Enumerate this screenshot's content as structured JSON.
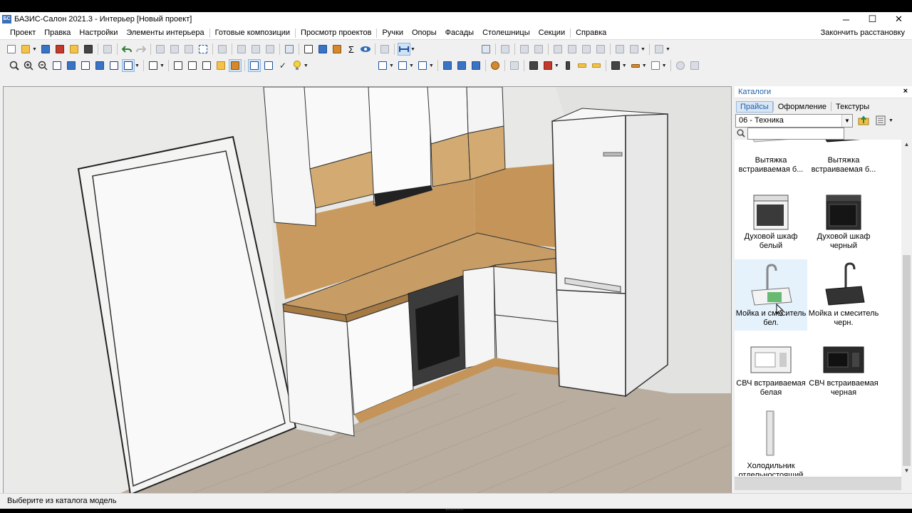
{
  "window": {
    "title": "БАЗИС-Салон 2021.3 - Интерьер [Новый проект]",
    "app_icon_text": "БС",
    "minimize_glyph": "─",
    "maximize_glyph": "☐",
    "close_glyph": "✕"
  },
  "menu": {
    "items": [
      "Проект",
      "Правка",
      "Настройки",
      "Элементы интерьера",
      "Готовые композиции",
      "Просмотр проектов",
      "Ручки",
      "Опоры",
      "Фасады",
      "Столешницы",
      "Секции",
      "Справка"
    ],
    "right_action": "Закончить расстановку"
  },
  "toolbar_icons": {
    "row1": [
      "new-icon",
      "open-icon",
      "save-icon",
      "save-as-icon",
      "export-icon",
      "print-icon",
      "home-icon",
      "undo-icon",
      "redo-icon",
      "cut-icon",
      "copy-icon",
      "paste-icon",
      "select-icon",
      "pick-icon",
      "group-icon",
      "ungroup-icon",
      "edit-icon",
      "layers-icon",
      "specification-icon",
      "3d-view-icon",
      "material-icon",
      "sum-icon",
      "eye-icon",
      "properties-icon",
      "measure-icon"
    ],
    "row2": [
      "zoom-all-icon",
      "zoom-in-icon",
      "zoom-out-icon",
      "view-front-icon",
      "view-left-icon",
      "view-top-icon",
      "view-right-icon",
      "view-iso-icon",
      "wireframe-icon",
      "camera-icon",
      "box-icon",
      "solid-icon",
      "texture-icon",
      "cube-icon",
      "frame-icon",
      "dimension-icon",
      "light-icon"
    ]
  },
  "catalog": {
    "panel_title": "Каталоги",
    "close_glyph": "×",
    "tabs": [
      "Прайсы",
      "Оформление",
      "Текстуры"
    ],
    "active_tab": "Прайсы",
    "selected_catalog": "06 - Техника",
    "search_placeholder": "",
    "items": [
      {
        "label": "Вытяжка встраиваемая б...",
        "color": "#d9d9d9",
        "kind": "hood-white"
      },
      {
        "label": "Вытяжка встраиваемая б...",
        "color": "#2a2a2a",
        "kind": "hood-black"
      },
      {
        "label": "Духовой шкаф белый",
        "color": "#f2f2f2",
        "kind": "oven-white"
      },
      {
        "label": "Духовой шкаф черный",
        "color": "#2d2d2d",
        "kind": "oven-black"
      },
      {
        "label": "Мойка и смеситель бел.",
        "color": "#eeeeee",
        "kind": "sink-white",
        "selected": true
      },
      {
        "label": "Мойка и смеситель черн.",
        "color": "#333333",
        "kind": "sink-black"
      },
      {
        "label": "СВЧ встраиваемая белая",
        "color": "#f2f2f2",
        "kind": "microwave-white"
      },
      {
        "label": "СВЧ встраиваемая черная",
        "color": "#2a2a2a",
        "kind": "microwave-black"
      },
      {
        "label": "Холодильник отдельностоящий",
        "color": "#e6e6e6",
        "kind": "fridge"
      }
    ]
  },
  "status": {
    "text": "Выберите из каталога модель"
  },
  "scene_colors": {
    "wall": "#e6e6e4",
    "floor": "#b9ad9f",
    "worktop": "#c79d65",
    "cabinet": "#f8f8f8",
    "fridge": "#f4f4f4"
  }
}
